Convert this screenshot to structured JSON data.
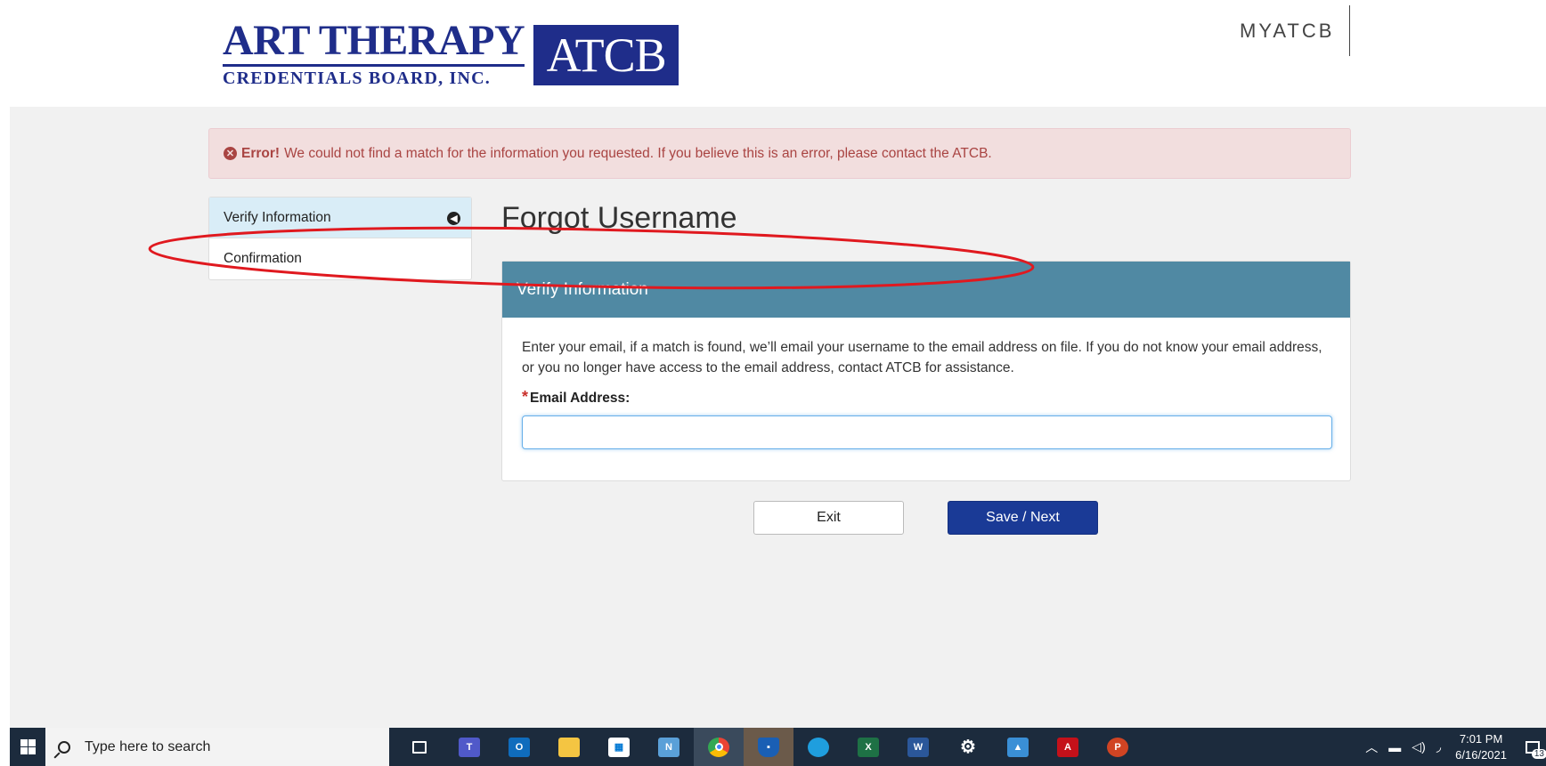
{
  "header": {
    "logo_main": "ART THERAPY",
    "logo_sub": "CREDENTIALS BOARD, INC.",
    "logo_box": "ATCB",
    "account_link": "MYATCB"
  },
  "alert": {
    "strong": "Error!",
    "message": "We could not find a match for the information you requested. If you believe this is an error, please contact the ATCB."
  },
  "steps": [
    {
      "label": "Verify Information",
      "active": true
    },
    {
      "label": "Confirmation",
      "active": false
    }
  ],
  "page": {
    "title": "Forgot Username"
  },
  "panel": {
    "heading": "Verify Information",
    "description": "Enter your email, if a match is found, we’ll email your username to the email address on file. If you do not know your email address, or you no longer have access to the email address, contact ATCB for assistance.",
    "required_marker": "*",
    "email_label": "Email Address:",
    "email_value": ""
  },
  "buttons": {
    "exit": "Exit",
    "save_next": "Save / Next"
  },
  "taskbar": {
    "search_placeholder": "Type here to search",
    "apps": [
      "task-view",
      "teams",
      "outlook",
      "file-explorer",
      "store",
      "nx",
      "chrome",
      "shield",
      "edge",
      "excel",
      "word",
      "settings",
      "photos",
      "acrobat",
      "powerpoint"
    ],
    "time": "7:01 PM",
    "date": "6/16/2021",
    "notification_count": "13"
  },
  "colors": {
    "brand_navy": "#1f2d8a",
    "panel_header": "#5089a3",
    "primary_button": "#1a3a96",
    "alert_bg": "#f2dede",
    "alert_text": "#a94442",
    "annotation": "#e0191f"
  }
}
